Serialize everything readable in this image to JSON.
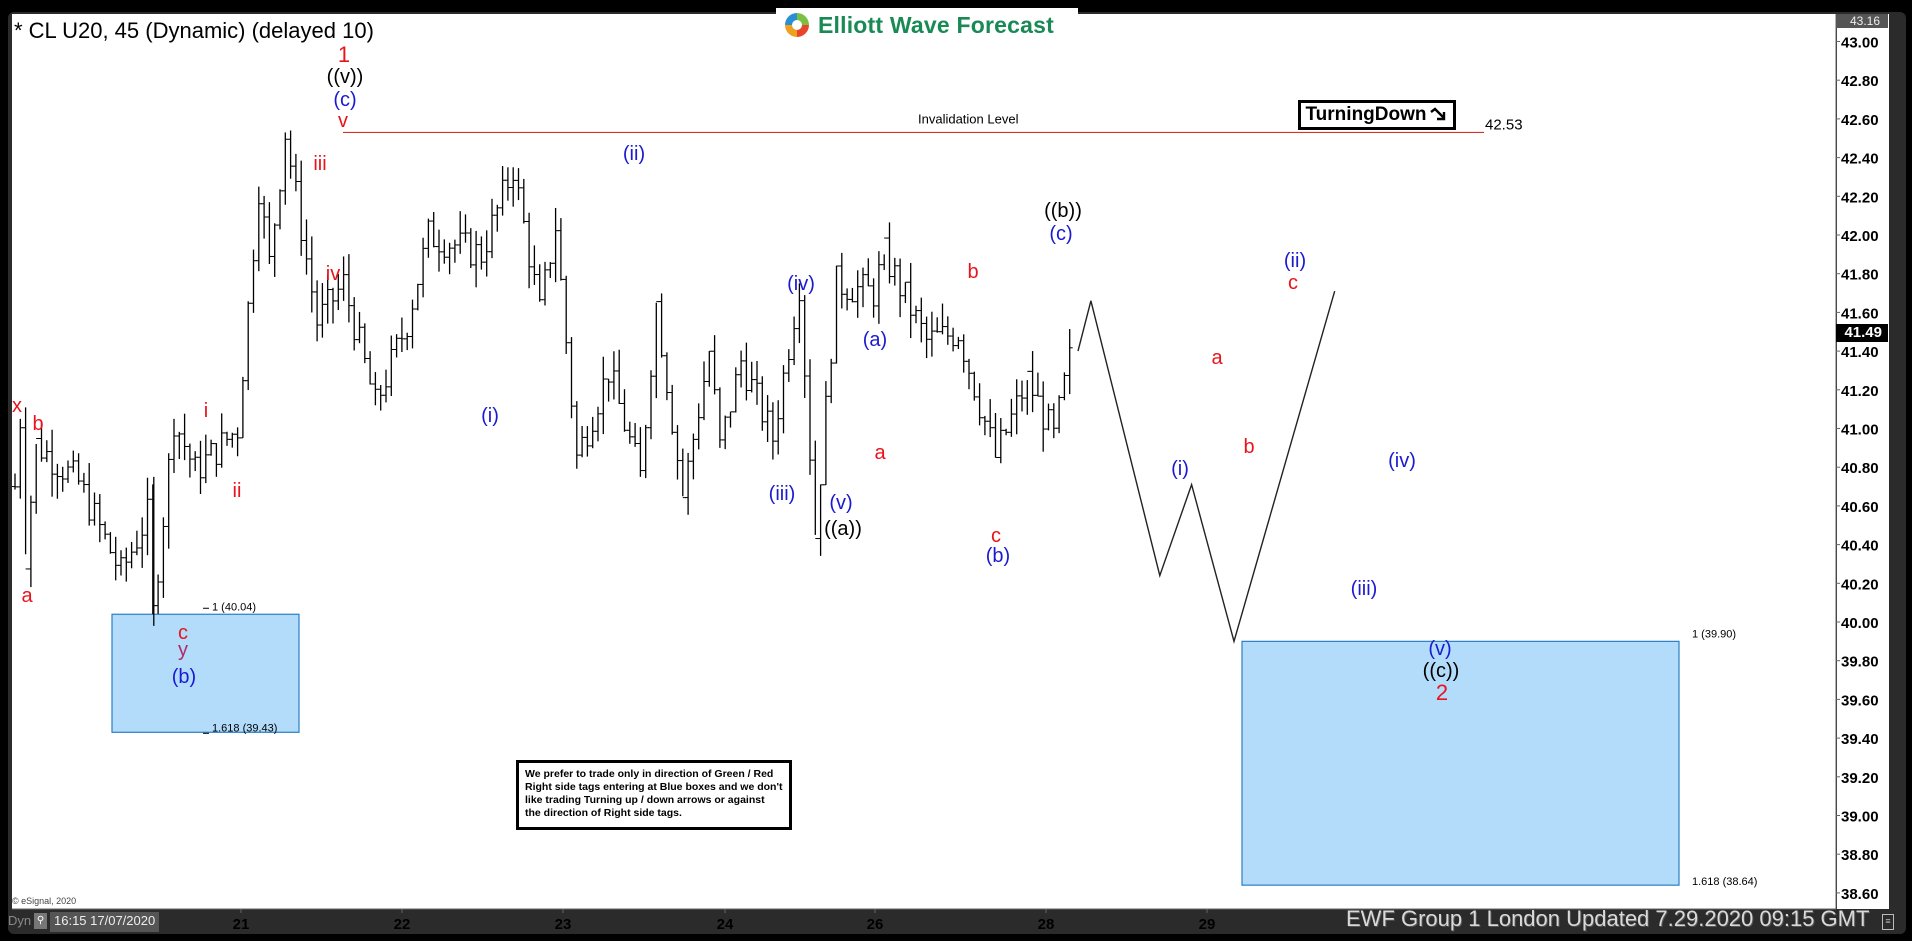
{
  "window": {
    "title": "* CL U20, 45 (Dynamic) (delayed 10)",
    "logo_text": "Elliott Wave Forecast",
    "footer": "EWF Group 1 London Updated 7.29.2020 09:15 GMT",
    "copyright": "© eSignal, 2020",
    "dyn_label": "Dyn",
    "start_time": "16:15 17/07/2020",
    "turning_label": "TurningDown",
    "turning_icon": "arrow-down-right-icon",
    "note": "We prefer to trade only in direction of Green / Red Right side tags entering at Blue boxes and we don't like trading Turning up / down arrows or against the direction of Right side tags.",
    "current_price_tag": "41.49",
    "top_price_tag": "43.16"
  },
  "colors": {
    "red": "#e8141c",
    "blue": "#1a1ad0",
    "black": "#000000",
    "box_fill": "#b3dcfb",
    "box_edge": "#2a7fc4",
    "invalidation": "#d9302c",
    "logo_green": "#1a8a55"
  },
  "chart_data": {
    "type": "ohlc",
    "symbol": "CL U20",
    "interval": "45 min",
    "ylim": [
      38.55,
      43.2
    ],
    "yticks": [
      "43.00",
      "42.80",
      "42.60",
      "42.40",
      "42.20",
      "42.00",
      "41.80",
      "41.60",
      "41.40",
      "41.20",
      "41.00",
      "40.80",
      "40.60",
      "40.40",
      "40.20",
      "40.00",
      "39.80",
      "39.60",
      "39.40",
      "39.20",
      "39.00",
      "38.80",
      "38.60"
    ],
    "xticks": [
      {
        "label": "21",
        "bar": 43
      },
      {
        "label": "22",
        "bar": 73
      },
      {
        "label": "23",
        "bar": 103
      },
      {
        "label": "24",
        "bar": 133
      },
      {
        "label": "26",
        "bar": 161
      },
      {
        "label": "28",
        "bar": 193
      },
      {
        "label": "29",
        "bar": 223
      }
    ],
    "bar_count": 238,
    "swing_points": [
      {
        "bar": 0,
        "price": 40.7
      },
      {
        "bar": 1,
        "price": 41.05,
        "label": "x"
      },
      {
        "bar": 2,
        "price": 40.35,
        "label": "a"
      },
      {
        "bar": 4,
        "price": 40.92,
        "label": "b"
      },
      {
        "bar": 12,
        "price": 40.72
      },
      {
        "bar": 20,
        "price": 40.25
      },
      {
        "bar": 25,
        "price": 40.55
      },
      {
        "bar": 26,
        "price": 40.04,
        "label": "c y (b)"
      },
      {
        "bar": 30,
        "price": 41.05,
        "label": "i"
      },
      {
        "bar": 34,
        "price": 40.78,
        "label": "ii"
      },
      {
        "bar": 42,
        "price": 41.0
      },
      {
        "bar": 46,
        "price": 42.25,
        "label": "iii"
      },
      {
        "bar": 48,
        "price": 41.85,
        "label": "iv"
      },
      {
        "bar": 51,
        "price": 42.53,
        "label": "v (c) ((v)) 1"
      },
      {
        "bar": 57,
        "price": 41.55
      },
      {
        "bar": 62,
        "price": 41.75
      },
      {
        "bar": 68,
        "price": 41.12,
        "label": "(i)"
      },
      {
        "bar": 74,
        "price": 41.55
      },
      {
        "bar": 78,
        "price": 42.0
      },
      {
        "bar": 88,
        "price": 41.9
      },
      {
        "bar": 94,
        "price": 42.35,
        "label": "(ii)"
      },
      {
        "bar": 99,
        "price": 41.6
      },
      {
        "bar": 102,
        "price": 42.05
      },
      {
        "bar": 106,
        "price": 40.85
      },
      {
        "bar": 112,
        "price": 41.3
      },
      {
        "bar": 118,
        "price": 40.75,
        "label": "(iii)"
      },
      {
        "bar": 121,
        "price": 41.65,
        "label": "(iv)"
      },
      {
        "bar": 126,
        "price": 40.65,
        "label": "(v) ((a))"
      },
      {
        "bar": 131,
        "price": 41.4,
        "label": "(a)"
      },
      {
        "bar": 133,
        "price": 40.9,
        "label": "a"
      },
      {
        "bar": 137,
        "price": 41.35
      },
      {
        "bar": 143,
        "price": 40.95
      },
      {
        "bar": 148,
        "price": 41.75,
        "label": "b"
      },
      {
        "bar": 151,
        "price": 40.45,
        "label": "c (b)"
      },
      {
        "bar": 155,
        "price": 41.75
      },
      {
        "bar": 162,
        "price": 41.7
      },
      {
        "bar": 164,
        "price": 41.9,
        "label": "(c) ((b))"
      },
      {
        "bar": 172,
        "price": 41.45
      },
      {
        "bar": 178,
        "price": 41.5
      },
      {
        "bar": 185,
        "price": 40.85,
        "label": "(i)"
      },
      {
        "bar": 191,
        "price": 41.25,
        "label": "a"
      },
      {
        "bar": 196,
        "price": 40.95,
        "label": "b"
      },
      {
        "bar": 200,
        "price": 41.49
      }
    ],
    "projection": [
      {
        "bar": 200,
        "price": 41.4
      },
      {
        "bar": 203,
        "price": 41.66,
        "label": "c (ii)"
      },
      {
        "bar": 216,
        "price": 40.24,
        "label": "(iii)"
      },
      {
        "bar": 222,
        "price": 40.71,
        "label": "(iv)"
      },
      {
        "bar": 230,
        "price": 39.9,
        "label": "(v) ((c)) 2"
      },
      {
        "bar": 249,
        "price": 41.71
      }
    ],
    "invalidation": {
      "label": "Invalidation Level",
      "price": 42.53,
      "price_label": "42.53"
    },
    "blue_boxes": [
      {
        "name": "left-box",
        "top": 40.04,
        "bottom": 39.43,
        "top_label": "1 (40.04)",
        "bottom_label": "1.618 (39.43)"
      },
      {
        "name": "right-box",
        "top": 39.9,
        "bottom": 38.64,
        "top_label": "1 (39.90)",
        "bottom_label": "1.618 (38.64)"
      }
    ],
    "labels": [
      {
        "text": "x",
        "color": "red",
        "x": 17,
        "y": 412
      },
      {
        "text": "a",
        "color": "red",
        "x": 27,
        "y": 602
      },
      {
        "text": "b",
        "color": "red",
        "x": 38,
        "y": 430
      },
      {
        "text": "c",
        "color": "red",
        "x": 183,
        "y": 639
      },
      {
        "text": "y",
        "color": "purple",
        "x": 183,
        "y": 656
      },
      {
        "text": "(b)",
        "color": "blue",
        "x": 184,
        "y": 683
      },
      {
        "text": "i",
        "color": "red",
        "x": 206,
        "y": 417
      },
      {
        "text": "ii",
        "color": "red",
        "x": 237,
        "y": 497
      },
      {
        "text": "iii",
        "color": "red",
        "x": 320,
        "y": 170
      },
      {
        "text": "iv",
        "color": "red",
        "x": 333,
        "y": 280
      },
      {
        "text": "v",
        "color": "red",
        "x": 343,
        "y": 127
      },
      {
        "text": "(c)",
        "color": "blue",
        "x": 345,
        "y": 106
      },
      {
        "text": "((v))",
        "color": "black",
        "x": 345,
        "y": 83
      },
      {
        "text": "1",
        "color": "red",
        "x": 344,
        "y": 62
      },
      {
        "text": "(i)",
        "color": "blue",
        "x": 490,
        "y": 422
      },
      {
        "text": "(ii)",
        "color": "blue",
        "x": 634,
        "y": 160
      },
      {
        "text": "(iii)",
        "color": "blue",
        "x": 782,
        "y": 500
      },
      {
        "text": "(iv)",
        "color": "blue",
        "x": 801,
        "y": 290
      },
      {
        "text": "(v)",
        "color": "blue",
        "x": 841,
        "y": 509
      },
      {
        "text": "((a))",
        "color": "black",
        "x": 843,
        "y": 535
      },
      {
        "text": "(a)",
        "color": "blue",
        "x": 875,
        "y": 346
      },
      {
        "text": "a",
        "color": "red",
        "x": 880,
        "y": 459
      },
      {
        "text": "b",
        "color": "red",
        "x": 973,
        "y": 278
      },
      {
        "text": "c",
        "color": "red",
        "x": 996,
        "y": 542
      },
      {
        "text": "(b)",
        "color": "blue",
        "x": 998,
        "y": 562
      },
      {
        "text": "((b))",
        "color": "black",
        "x": 1063,
        "y": 217
      },
      {
        "text": "(c)",
        "color": "blue",
        "x": 1061,
        "y": 240
      },
      {
        "text": "(i)",
        "color": "blue",
        "x": 1180,
        "y": 475
      },
      {
        "text": "a",
        "color": "red",
        "x": 1217,
        "y": 364
      },
      {
        "text": "b",
        "color": "red",
        "x": 1249,
        "y": 453
      },
      {
        "text": "(ii)",
        "color": "blue",
        "x": 1295,
        "y": 267
      },
      {
        "text": "c",
        "color": "red",
        "x": 1293,
        "y": 289
      },
      {
        "text": "(iii)",
        "color": "blue",
        "x": 1364,
        "y": 595
      },
      {
        "text": "(iv)",
        "color": "blue",
        "x": 1402,
        "y": 467
      },
      {
        "text": "(v)",
        "color": "blue",
        "x": 1440,
        "y": 655
      },
      {
        "text": "((c))",
        "color": "black",
        "x": 1441,
        "y": 677
      },
      {
        "text": "2",
        "color": "red",
        "x": 1442,
        "y": 700
      }
    ]
  }
}
